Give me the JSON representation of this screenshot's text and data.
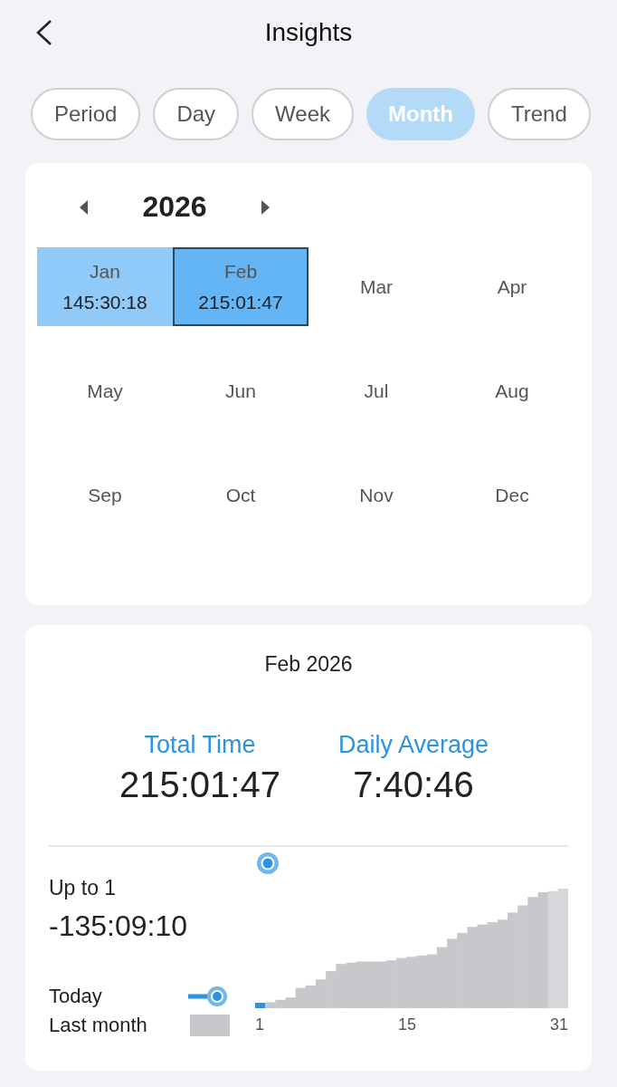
{
  "header": {
    "title": "Insights"
  },
  "tabs": [
    {
      "label": "Period",
      "selected": false
    },
    {
      "label": "Day",
      "selected": false
    },
    {
      "label": "Week",
      "selected": false
    },
    {
      "label": "Month",
      "selected": true
    },
    {
      "label": "Trend",
      "selected": false
    }
  ],
  "calendar": {
    "year": "2026",
    "months": [
      {
        "label": "Jan",
        "value": "145:30:18",
        "selected": false,
        "color": "#90caf9"
      },
      {
        "label": "Feb",
        "value": "215:01:47",
        "selected": true,
        "color": "#64b5f6"
      },
      {
        "label": "Mar",
        "selected": false
      },
      {
        "label": "Apr",
        "selected": false
      },
      {
        "label": "May",
        "selected": false
      },
      {
        "label": "Jun",
        "selected": false
      },
      {
        "label": "Jul",
        "selected": false
      },
      {
        "label": "Aug",
        "selected": false
      },
      {
        "label": "Sep",
        "selected": false
      },
      {
        "label": "Oct",
        "selected": false
      },
      {
        "label": "Nov",
        "selected": false
      },
      {
        "label": "Dec",
        "selected": false
      }
    ]
  },
  "summary": {
    "title": "Feb 2026",
    "stats": [
      {
        "label": "Total Time",
        "value": "215:01:47"
      },
      {
        "label": "Daily Average",
        "value": "7:40:46"
      }
    ]
  },
  "comparison": {
    "label": "Up to 1",
    "value": "-135:09:10",
    "legend": [
      {
        "label": "Today",
        "kind": "line"
      },
      {
        "label": "Last month",
        "kind": "area"
      }
    ],
    "axis_labels": [
      "1",
      "15",
      "31"
    ]
  }
}
